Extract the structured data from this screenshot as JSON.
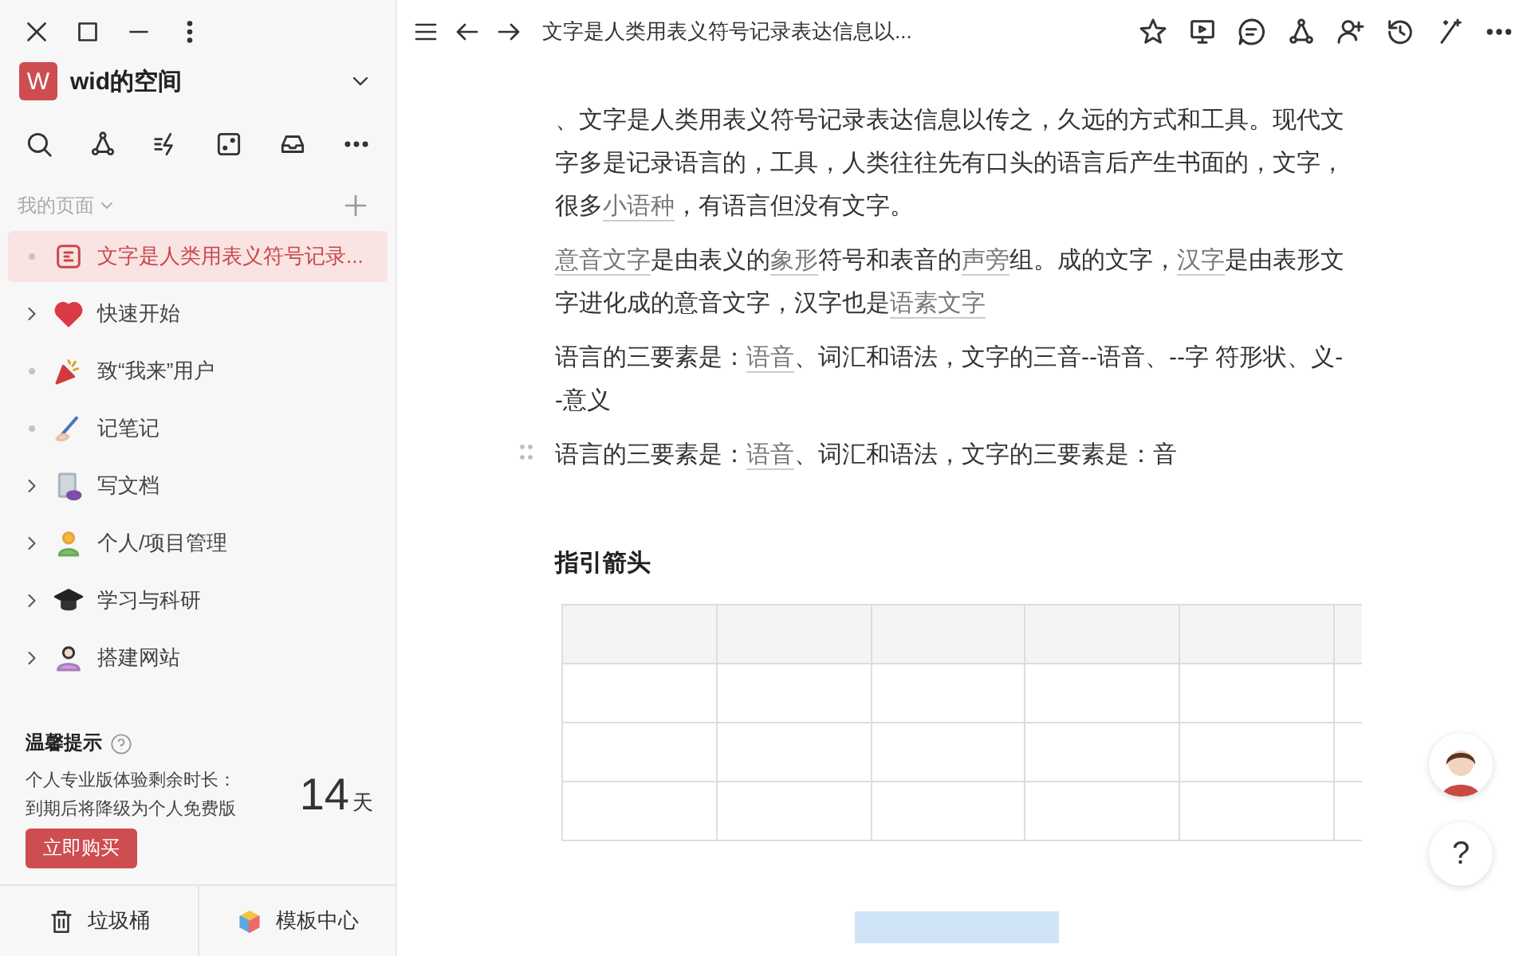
{
  "workspace": {
    "initial": "W",
    "name": "wid的空间"
  },
  "section_label": "我的页面",
  "pages": [
    {
      "title": "文字是人类用表义符号记录...",
      "selected": true,
      "has_children": false
    },
    {
      "title": "快速开始",
      "selected": false,
      "has_children": true
    },
    {
      "title": "致“我来”用户",
      "selected": false,
      "has_children": false
    },
    {
      "title": "记笔记",
      "selected": false,
      "has_children": false
    },
    {
      "title": "写文档",
      "selected": false,
      "has_children": true
    },
    {
      "title": "个人/项目管理",
      "selected": false,
      "has_children": true
    },
    {
      "title": "学习与科研",
      "selected": false,
      "has_children": true
    },
    {
      "title": "搭建网站",
      "selected": false,
      "has_children": true
    }
  ],
  "notice": {
    "title": "温馨提示",
    "lines": [
      "个人专业版体验剩余时长：",
      "到期后将降级为个人免费版"
    ],
    "days": "14",
    "unit": "天",
    "button": "立即购买"
  },
  "footer": [
    "垃圾桶",
    "模板中心"
  ],
  "topbar": {
    "title": "文字是人类用表义符号记录表达信息以..."
  },
  "paragraphs": [
    {
      "handle": false,
      "segments": [
        {
          "text": "、文字是人类用表义符号记录表达信息以传之，久远的方式和工具。现代文字多是记录语言的，工具，人类往往先有口头的语言后产生书面的，文字，很多",
          "link": false
        },
        {
          "text": "小语种",
          "link": true
        },
        {
          "text": "，有语言但没有文字。",
          "link": false
        }
      ]
    },
    {
      "handle": false,
      "segments": [
        {
          "text": "意音文字",
          "link": true
        },
        {
          "text": "是由表义的",
          "link": false
        },
        {
          "text": "象形",
          "link": true
        },
        {
          "text": "符号和表音的",
          "link": false
        },
        {
          "text": "声旁",
          "link": true
        },
        {
          "text": "组。成的文字，",
          "link": false
        },
        {
          "text": "汉字",
          "link": true
        },
        {
          "text": "是由表形文字进化成的意音文字，汉字也是",
          "link": false
        },
        {
          "text": "语素文字",
          "link": true
        }
      ]
    },
    {
      "handle": false,
      "segments": [
        {
          "text": "语言的三要素是：",
          "link": false
        },
        {
          "text": "语音",
          "link": true
        },
        {
          "text": "、词汇和语法，文字的三音--语音、--字 符形状、义--意义",
          "link": false
        }
      ]
    },
    {
      "handle": true,
      "segments": [
        {
          "text": "语言的三要素是：",
          "link": false
        },
        {
          "text": "语音",
          "link": true
        },
        {
          "text": "、词汇和语法，文字的三要素是：音",
          "link": false
        }
      ]
    }
  ],
  "heading": "指引箭头",
  "table": {
    "rows": [
      {
        "kind": "header"
      },
      {
        "kind": "body"
      },
      {
        "kind": "body"
      },
      {
        "kind": "body"
      }
    ]
  },
  "help_button": "?"
}
